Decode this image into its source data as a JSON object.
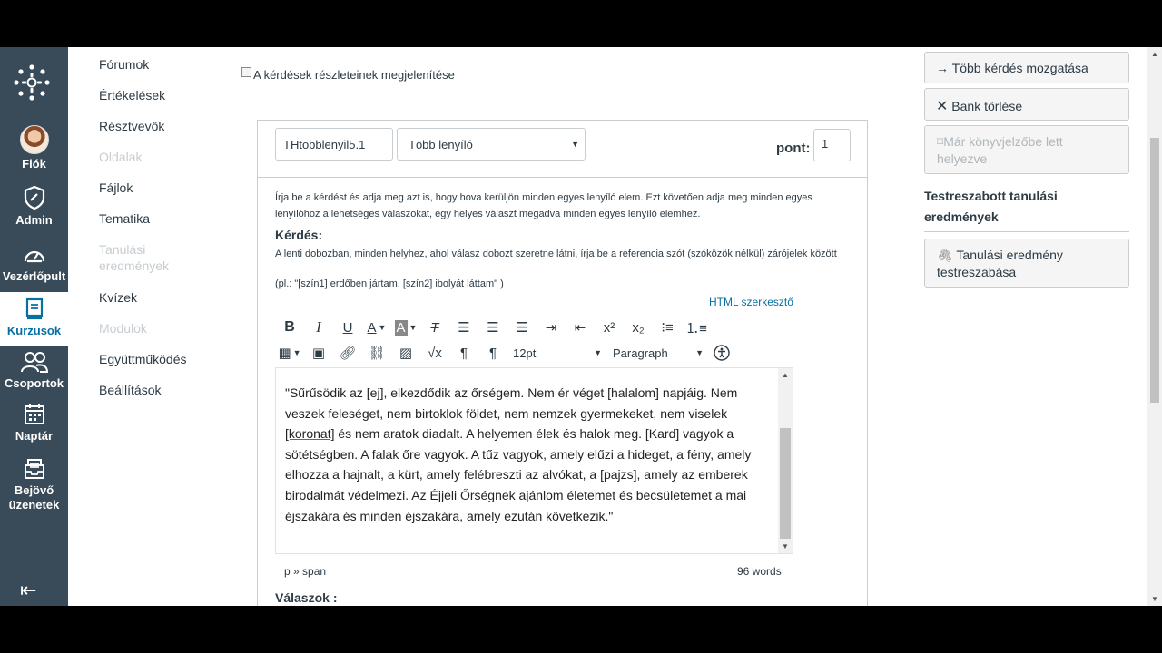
{
  "global_nav": {
    "items": [
      {
        "label": "Fiók",
        "icon": "avatar"
      },
      {
        "label": "Admin",
        "icon": "shield-icon"
      },
      {
        "label": "Vezérlőpult",
        "icon": "dashboard-icon"
      },
      {
        "label": "Kurzusok",
        "icon": "book-icon",
        "active": true
      },
      {
        "label": "Csoportok",
        "icon": "people-icon"
      },
      {
        "label": "Naptár",
        "icon": "calendar-icon"
      },
      {
        "label": "Bejövő üzenetek",
        "line1": "Bejövő",
        "line2": "üzenetek",
        "icon": "inbox-icon"
      }
    ],
    "accent": "#0770A3",
    "background": "#394B58"
  },
  "course_nav": {
    "items": [
      {
        "label": "Fórumok"
      },
      {
        "label": "Értékelések"
      },
      {
        "label": "Résztvevők"
      },
      {
        "label": "Oldalak",
        "disabled": true
      },
      {
        "label": "Fájlok"
      },
      {
        "label": "Tematika"
      },
      {
        "label": "Tanulási eredmények",
        "line1": "Tanulási",
        "line2": "eredmények",
        "disabled": true
      },
      {
        "label": "Kvízek"
      },
      {
        "label": "Modulok",
        "disabled": true
      },
      {
        "label": "Együttműködés"
      },
      {
        "label": "Beállítások"
      }
    ]
  },
  "main": {
    "details_toggle": "A kérdések részleteinek megjelenítése",
    "question": {
      "name": "THtobblenyil5.1",
      "type": "Több lenyíló",
      "points_label": "pont:",
      "points": "1",
      "instructions": "Írja be a kérdést és adja meg azt is, hogy hova kerüljön minden egyes lenyíló elem. Ezt követően adja meg minden egyes lenyílóhoz a lehetséges válaszokat, egy helyes választ megadva minden egyes lenyíló elemhez.",
      "question_label": "Kérdés:",
      "question_help": "A lenti dobozban, minden helyhez, ahol válasz dobozt szeretne látni, írja be a referencia szót (szóközök nélkül) zárójelek között",
      "question_example": "(pl.: \"[szín1] erdőben jártam, [szín2] ibolyát láttam\" )",
      "html_editor_link": "HTML szerkesztő",
      "font_size": "12pt",
      "block_format": "Paragraph",
      "editor_text": {
        "p1": "\"Sűrűsödik az [ej], elkezdődik az őrségem. Nem ér véget [halalom] napjáig. Nem veszek feleséget, nem birtoklok földet, nem nemzek gyermekeket, nem viselek ",
        "underlined": "[koronat]",
        "p2": " és nem aratok diadalt. A helyemen élek és halok meg. [Kard] vagyok a sötétségben. A falak őre vagyok. A tűz vagyok, amely elűzi a hideget, a fény, amely elhozza a hajnalt, a kürt, amely felébreszti az alvókat, a [pajzs], amely az emberek birodalmát védelmezi. Az Éjjeli Őrségnek ajánlom életemet és becsületemet a mai éjszakára és minden éjszakára, amely ezután következik.\""
      },
      "status_path": "p » span",
      "word_count": "96 words",
      "answers_label": "Válaszok :"
    }
  },
  "right_sidebar": {
    "move_button": "Több kérdés mozgatása",
    "delete_button": "Bank törlése",
    "bookmarked_line1": "Már könyvjelzőbe lett",
    "bookmarked_line2": "helyezve",
    "outcomes_heading_line1": "Testreszabott tanulási",
    "outcomes_heading_line2": "eredmények",
    "outcome_button_line1": "Tanulási eredmény",
    "outcome_button_line2": "testreszabása"
  }
}
